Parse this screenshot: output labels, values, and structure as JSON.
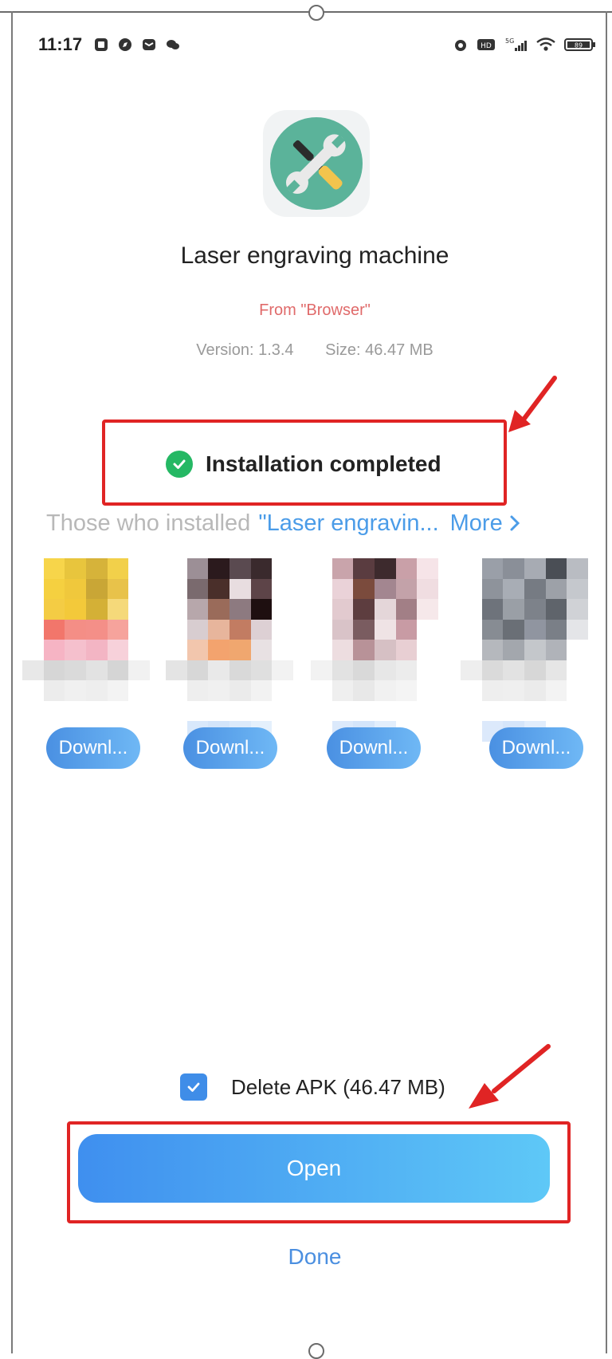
{
  "status_bar": {
    "time": "11:17",
    "battery": "89"
  },
  "app": {
    "name": "Laser engraving machine",
    "source": "From \"Browser\"",
    "version": "Version: 1.3.4",
    "size": "Size: 46.47 MB",
    "icon": "wrench-screwdriver-icon"
  },
  "install": {
    "status_text": "Installation completed"
  },
  "recommend": {
    "prefix": "Those who installed",
    "app_ref": "\"Laser engravin...",
    "more": "More",
    "items": [
      {
        "download_label": "Downl..."
      },
      {
        "download_label": "Downl..."
      },
      {
        "download_label": "Downl..."
      },
      {
        "download_label": "Downl..."
      }
    ]
  },
  "actions": {
    "delete_apk_label": "Delete APK (46.47 MB)",
    "delete_apk_checked": true,
    "open_label": "Open",
    "done_label": "Done"
  },
  "colors": {
    "highlight": "#e02424",
    "accent": "#4b9ce8",
    "success": "#25b864",
    "source_text": "#e06a6a"
  }
}
